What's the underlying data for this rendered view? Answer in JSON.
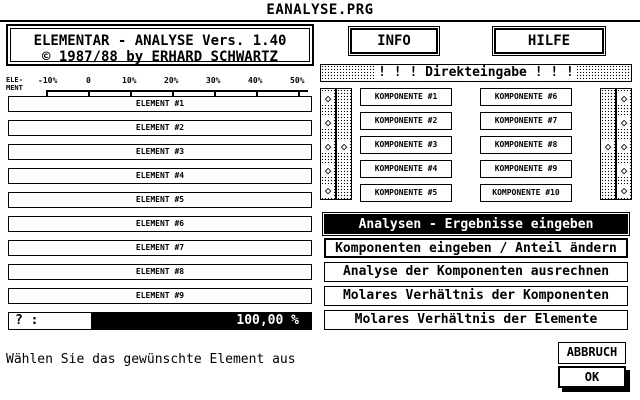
{
  "window": {
    "title": "EANALYSE.PRG"
  },
  "app": {
    "line1": "ELEMENTAR - ANALYSE  Vers.  1.40",
    "line2": "© 1987/88 by ERHARD SCHWARTZ"
  },
  "buttons": {
    "info": "INFO",
    "hilfe": "HILFE",
    "abbruch": "ABBRUCH",
    "ok": "OK"
  },
  "scale": {
    "corner_label_1": "ELE-",
    "corner_label_2": "MENT",
    "ticks": [
      "-10%",
      "0",
      "10%",
      "20%",
      "30%",
      "40%",
      "50%"
    ]
  },
  "elements": [
    "ELEMENT #1",
    "ELEMENT #2",
    "ELEMENT #3",
    "ELEMENT #4",
    "ELEMENT #5",
    "ELEMENT #6",
    "ELEMENT #7",
    "ELEMENT #8",
    "ELEMENT #9"
  ],
  "prompt": {
    "label": "? :",
    "value": "100,00 %"
  },
  "status": "Wählen Sie das gewünschte Element aus",
  "direkt": {
    "label": "! ! !   Direkteingabe   ! ! !"
  },
  "komponenten_left": [
    "KOMPONENTE #1",
    "KOMPONENTE #2",
    "KOMPONENTE #3",
    "KOMPONENTE #4",
    "KOMPONENTE #5"
  ],
  "komponenten_right": [
    "KOMPONENTE #6",
    "KOMPONENTE #7",
    "KOMPONENTE #8",
    "KOMPONENTE #9",
    "KOMPONENTE #10"
  ],
  "side_markers": {
    "left": "◇",
    "right": "◇"
  },
  "menu": [
    "Analysen - Ergebnisse eingeben",
    "Komponenten eingeben / Anteil ändern",
    "Analyse der Komponenten ausrechnen",
    "Molares Verhältnis der Komponenten",
    "Molares Verhältnis der Elemente"
  ]
}
